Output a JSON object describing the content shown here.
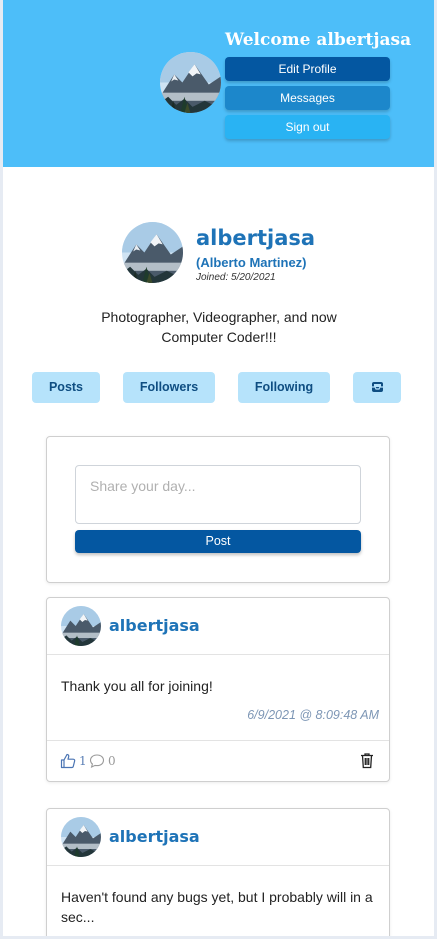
{
  "header": {
    "welcome": "Welcome albertjasa",
    "edit_profile": "Edit Profile",
    "messages": "Messages",
    "sign_out": "Sign out"
  },
  "profile": {
    "username": "albertjasa",
    "real_name": "(Alberto Martinez)",
    "joined": "Joined: 5/20/2021",
    "bio": "Photographer, Videographer, and now Computer Coder!!!"
  },
  "tabs": [
    {
      "label": "Posts"
    },
    {
      "label": "Followers"
    },
    {
      "label": "Following"
    },
    {
      "icon": "inbox-icon"
    }
  ],
  "compose": {
    "placeholder": "Share your day...",
    "post_label": "Post"
  },
  "posts": [
    {
      "username": "albertjasa",
      "text": "Thank you all for joining!",
      "date": "6/9/2021 @ 8:09:48 AM",
      "likes": "1",
      "comments": "0"
    },
    {
      "username": "albertjasa",
      "text": "Haven't found any bugs yet, but I probably will in a sec..."
    }
  ],
  "colors": {
    "header_bg": "#4dbef9",
    "primary": "#0457a1",
    "accent_text": "#1e73b7",
    "tab_bg": "#b6e3fb"
  }
}
